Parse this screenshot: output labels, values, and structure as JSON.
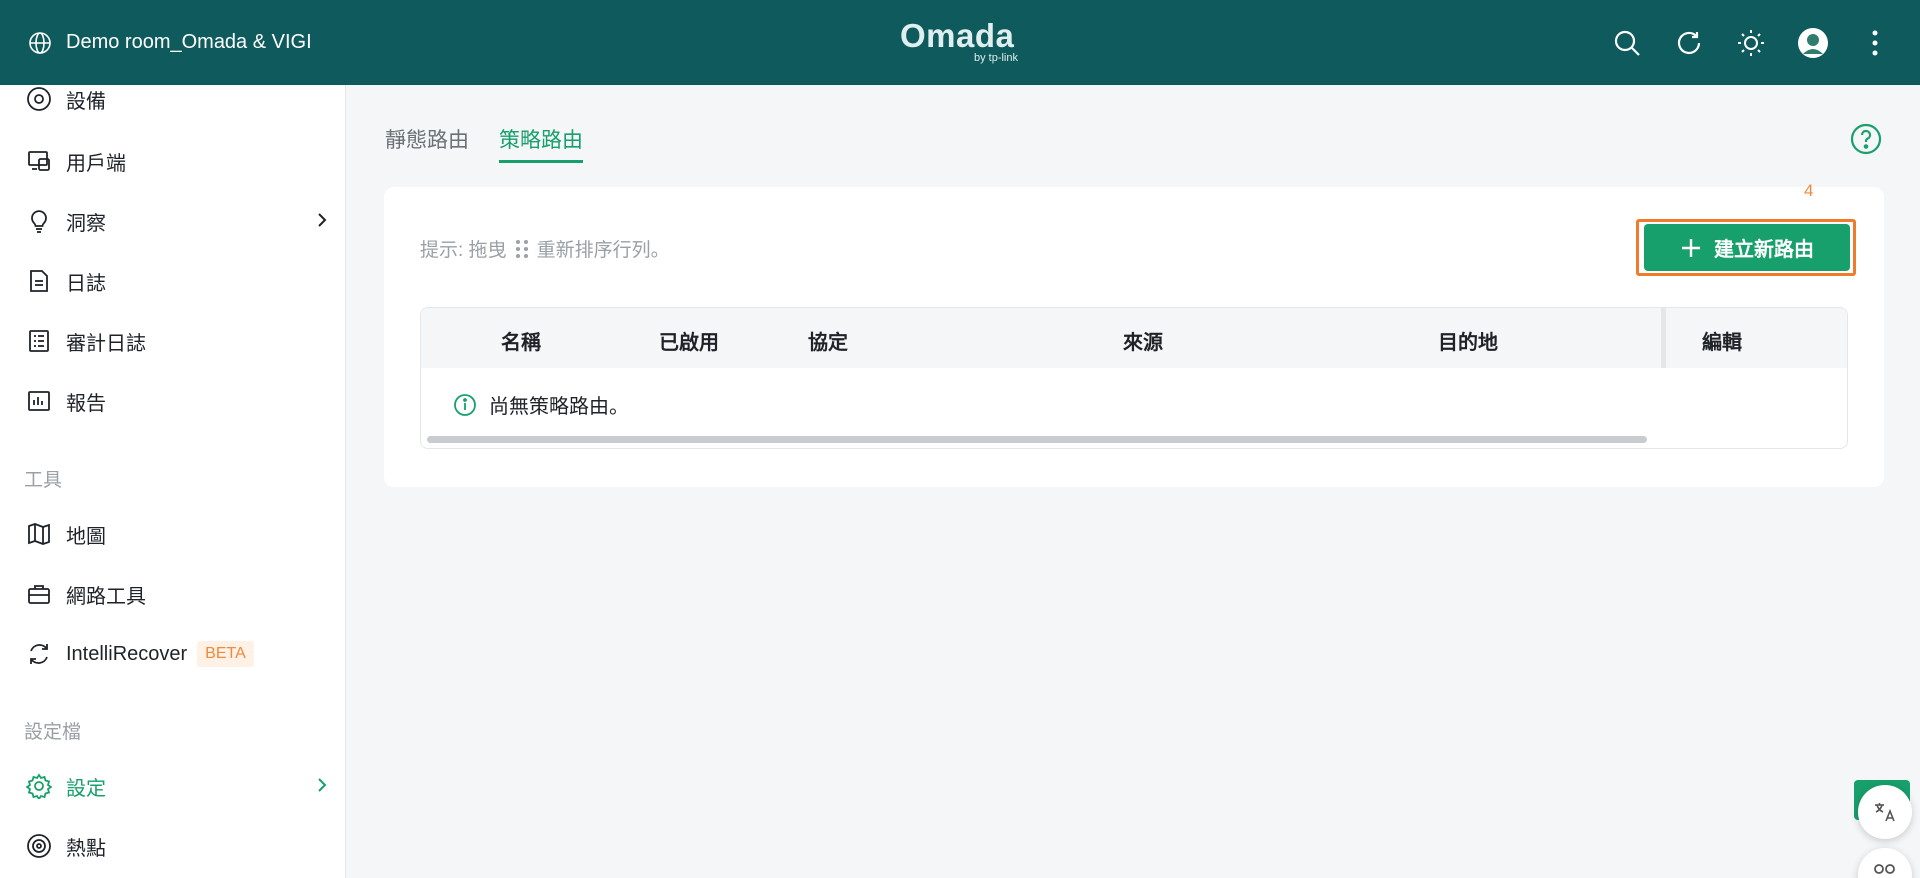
{
  "header": {
    "site_name": "Demo room_Omada & VIGI",
    "logo_brand": "Omada",
    "logo_by": "by tp-link"
  },
  "sidebar": {
    "items": [
      {
        "label": "設備",
        "icon": "device-icon"
      },
      {
        "label": "用戶端",
        "icon": "clients-icon"
      },
      {
        "label": "洞察",
        "icon": "bulb-icon"
      },
      {
        "label": "日誌",
        "icon": "log-icon"
      },
      {
        "label": "審計日誌",
        "icon": "audit-log-icon"
      },
      {
        "label": "報告",
        "icon": "report-icon"
      }
    ],
    "tools_title": "工具",
    "tools": [
      {
        "label": "地圖",
        "icon": "map-icon"
      },
      {
        "label": "網路工具",
        "icon": "toolbox-icon"
      },
      {
        "label": "IntelliRecover",
        "icon": "recover-icon",
        "badge": "BETA"
      }
    ],
    "profile_title": "設定檔",
    "profile": [
      {
        "label": "設定",
        "icon": "gear-icon"
      },
      {
        "label": "熱點",
        "icon": "hotspot-icon"
      }
    ]
  },
  "tabs": [
    {
      "label": "靜態路由"
    },
    {
      "label": "策略路由"
    }
  ],
  "card": {
    "hint_prefix": "提示: 拖曳",
    "hint_suffix": "重新排序行列。",
    "step_number": "4",
    "create_button": "建立新路由"
  },
  "table": {
    "columns": [
      "名稱",
      "已啟用",
      "協定",
      "來源",
      "目的地",
      "編輯"
    ],
    "empty_message": "尚無策略路由。"
  },
  "colors": {
    "header_bg": "#0e5a5c",
    "accent": "#17a06b",
    "highlight": "#f07b2a"
  }
}
